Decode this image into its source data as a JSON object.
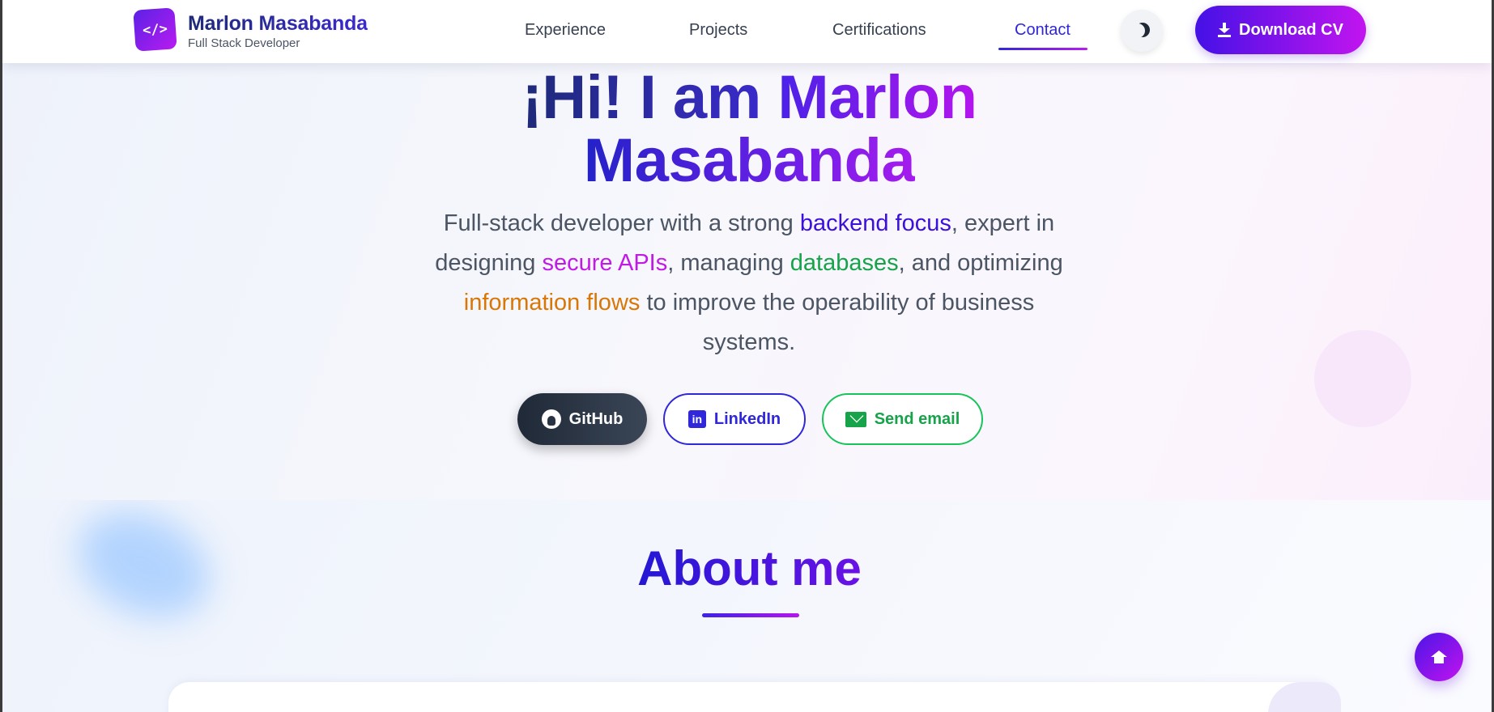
{
  "brand": {
    "logo_glyph": "</>",
    "name": "Marlon Masabanda",
    "subtitle": "Full Stack Developer"
  },
  "nav": {
    "items": [
      {
        "label": "Experience"
      },
      {
        "label": "Projects"
      },
      {
        "label": "Certifications"
      },
      {
        "label": "Contact",
        "active": true
      }
    ],
    "theme_toggle_icon": "moon-icon",
    "download_label": "Download CV"
  },
  "hero": {
    "title_part1": "¡Hi! I am ",
    "title_part2": "Marlon",
    "title_part3": "Masabanda",
    "description": {
      "s1": "Full-stack developer with a strong ",
      "h1": "backend focus",
      "s2": ", expert in designing ",
      "h2": "secure APIs",
      "s3": ", managing ",
      "h3": "databases",
      "s4": ", and optimizing ",
      "h4": "information flows",
      "s5": " to improve the operability of business systems."
    },
    "buttons": {
      "github": "GitHub",
      "linkedin": "LinkedIn",
      "linkedin_glyph": "in",
      "email": "Send email"
    }
  },
  "about": {
    "title": "About me"
  },
  "fab": {
    "icon": "home-icon"
  },
  "colors": {
    "accent_blue": "#2f27d9",
    "accent_purple": "#c21ae6",
    "accent_green": "#16a34a",
    "accent_orange": "#d97706"
  }
}
